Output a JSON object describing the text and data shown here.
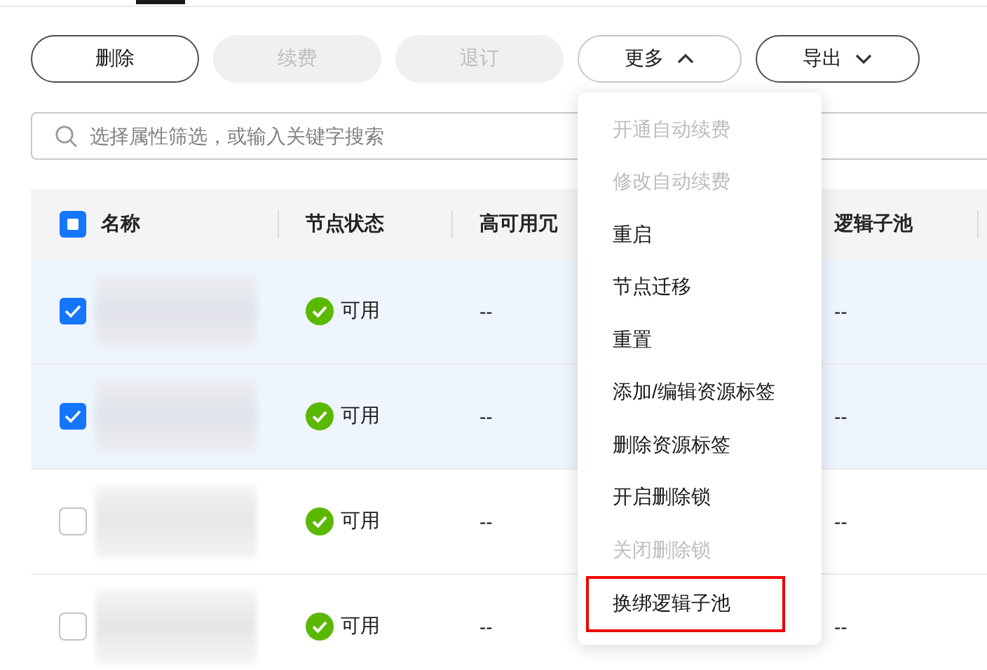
{
  "toolbar": [
    {
      "label": "删除",
      "disabled": false,
      "kind": "plain"
    },
    {
      "label": "续费",
      "disabled": true,
      "kind": "plain"
    },
    {
      "label": "退订",
      "disabled": true,
      "kind": "plain"
    },
    {
      "label": "更多",
      "disabled": false,
      "kind": "dropdown",
      "expanded": true
    },
    {
      "label": "导出",
      "disabled": false,
      "kind": "dropdown",
      "expanded": false
    }
  ],
  "search": {
    "placeholder": "选择属性筛选，或输入关键字搜索"
  },
  "table": {
    "select_all": {
      "indeterminate": true
    },
    "columns": [
      "名称",
      "节点状态",
      "高可用冗",
      "逻辑子池"
    ],
    "rows": [
      {
        "checked": true,
        "status": "可用",
        "column_3": "--",
        "pool": "--"
      },
      {
        "checked": true,
        "status": "可用",
        "column_3": "--",
        "pool": "--"
      },
      {
        "checked": false,
        "status": "可用",
        "column_3": "--",
        "pool": "--"
      },
      {
        "checked": false,
        "status": "可用",
        "column_3": "--",
        "pool": "--"
      }
    ]
  },
  "menu": [
    {
      "label": "开通自动续费",
      "disabled": true,
      "highlighted": false
    },
    {
      "label": "修改自动续费",
      "disabled": true,
      "highlighted": false
    },
    {
      "label": "重启",
      "disabled": false,
      "highlighted": false
    },
    {
      "label": "节点迁移",
      "disabled": false,
      "highlighted": false
    },
    {
      "label": "重置",
      "disabled": false,
      "highlighted": false
    },
    {
      "label": "添加/编辑资源标签",
      "disabled": false,
      "highlighted": false
    },
    {
      "label": "删除资源标签",
      "disabled": false,
      "highlighted": false
    },
    {
      "label": "开启删除锁",
      "disabled": false,
      "highlighted": false
    },
    {
      "label": "关闭删除锁",
      "disabled": true,
      "highlighted": false
    },
    {
      "label": "换绑逻辑子池",
      "disabled": false,
      "highlighted": true
    }
  ]
}
